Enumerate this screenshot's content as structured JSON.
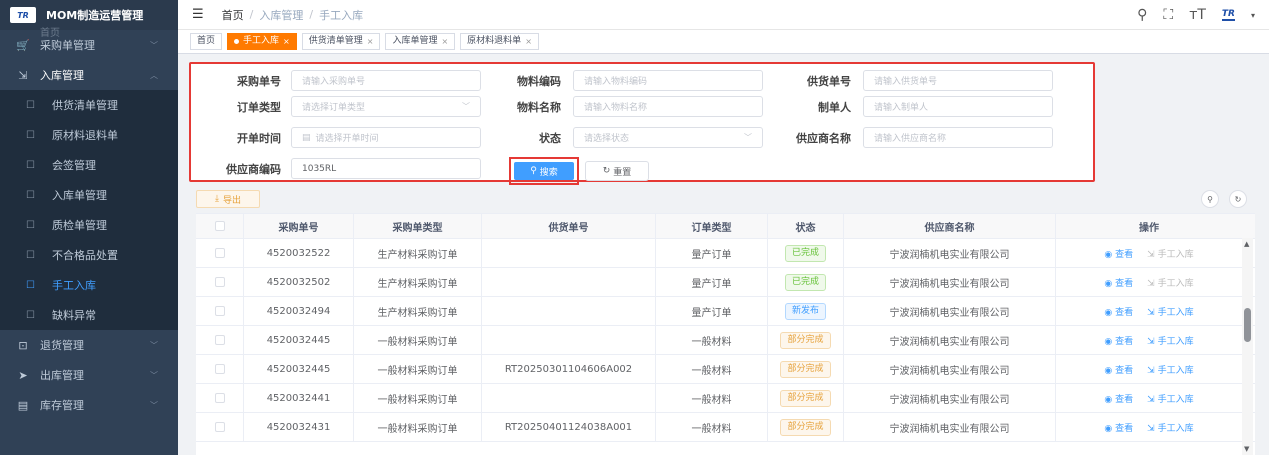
{
  "app": {
    "logo": "TR",
    "title": "MOM制造运营管理",
    "ghost_item": "首页"
  },
  "sidebar": {
    "menu": [
      {
        "label": "采购单管理",
        "icon": "cart-icon",
        "glyph": "🛒",
        "arrow": "﹀",
        "open": false
      },
      {
        "label": "入库管理",
        "icon": "inbox-icon",
        "glyph": "⇲",
        "arrow": "︿",
        "open": true
      }
    ],
    "submenu": [
      {
        "label": "供货清单管理",
        "active": false
      },
      {
        "label": "原材料退料单",
        "active": false
      },
      {
        "label": "会签管理",
        "active": false
      },
      {
        "label": "入库单管理",
        "active": false
      },
      {
        "label": "质检单管理",
        "active": false
      },
      {
        "label": "不合格品处置",
        "active": false
      },
      {
        "label": "手工入库",
        "active": true
      },
      {
        "label": "缺料异常",
        "active": false
      }
    ],
    "menu_after": [
      {
        "label": "退货管理",
        "icon": "return-icon",
        "glyph": "⊡",
        "arrow": "﹀"
      },
      {
        "label": "出库管理",
        "icon": "send-icon",
        "glyph": "➤",
        "arrow": "﹀"
      },
      {
        "label": "库存管理",
        "icon": "warehouse-icon",
        "glyph": "▤",
        "arrow": "﹀"
      }
    ]
  },
  "header": {
    "breadcrumb": [
      "首页",
      "入库管理",
      "手工入库"
    ],
    "brand": "TR"
  },
  "tags": [
    {
      "label": "首页",
      "active": false,
      "closable": false
    },
    {
      "label": "手工入库",
      "active": true,
      "closable": true
    },
    {
      "label": "供货清单管理",
      "active": false,
      "closable": true
    },
    {
      "label": "入库单管理",
      "active": false,
      "closable": true
    },
    {
      "label": "原材料退料单",
      "active": false,
      "closable": true
    }
  ],
  "search": {
    "fields": {
      "purchase_no": {
        "label": "采购单号",
        "placeholder": "请输入采购单号",
        "value": ""
      },
      "material_code": {
        "label": "物料编码",
        "placeholder": "请输入物料编码",
        "value": ""
      },
      "supply_no": {
        "label": "供货单号",
        "placeholder": "请输入供货单号",
        "value": ""
      },
      "order_type": {
        "label": "订单类型",
        "placeholder": "请选择订单类型",
        "value": ""
      },
      "material_name": {
        "label": "物料名称",
        "placeholder": "请输入物料名称",
        "value": ""
      },
      "creator": {
        "label": "制单人",
        "placeholder": "请输入制单人",
        "value": ""
      },
      "open_time": {
        "label": "开单时间",
        "placeholder": "请选择开单时间",
        "value": ""
      },
      "status": {
        "label": "状态",
        "placeholder": "请选择状态",
        "value": ""
      },
      "supplier_name": {
        "label": "供应商名称",
        "placeholder": "请输入供应商名称",
        "value": ""
      },
      "supplier_code": {
        "label": "供应商编码",
        "placeholder": "",
        "value": "1035RL"
      }
    },
    "search_label": "搜索",
    "reset_label": "重置"
  },
  "toolbar": {
    "export_label": "导出"
  },
  "table": {
    "columns": [
      "采购单号",
      "采购单类型",
      "供货单号",
      "订单类型",
      "状态",
      "供应商名称",
      "操作"
    ],
    "view_label": "查看",
    "in_label": "手工入库",
    "rows": [
      {
        "po": "4520032522",
        "po_type": "生产材料采购订单",
        "supply": "",
        "order_type": "量产订单",
        "status": "已完成",
        "status_kind": "done",
        "supplier": "宁波润楠机电实业有限公司",
        "in_enabled": false
      },
      {
        "po": "4520032502",
        "po_type": "生产材料采购订单",
        "supply": "",
        "order_type": "量产订单",
        "status": "已完成",
        "status_kind": "done",
        "supplier": "宁波润楠机电实业有限公司",
        "in_enabled": false
      },
      {
        "po": "4520032494",
        "po_type": "生产材料采购订单",
        "supply": "",
        "order_type": "量产订单",
        "status": "新发布",
        "status_kind": "new",
        "supplier": "宁波润楠机电实业有限公司",
        "in_enabled": true
      },
      {
        "po": "4520032445",
        "po_type": "一般材料采购订单",
        "supply": "",
        "order_type": "一般材料",
        "status": "部分完成",
        "status_kind": "partial",
        "supplier": "宁波润楠机电实业有限公司",
        "in_enabled": true
      },
      {
        "po": "4520032445",
        "po_type": "一般材料采购订单",
        "supply": "RT20250301104606A002",
        "order_type": "一般材料",
        "status": "部分完成",
        "status_kind": "partial",
        "supplier": "宁波润楠机电实业有限公司",
        "in_enabled": true
      },
      {
        "po": "4520032441",
        "po_type": "一般材料采购订单",
        "supply": "",
        "order_type": "一般材料",
        "status": "部分完成",
        "status_kind": "partial",
        "supplier": "宁波润楠机电实业有限公司",
        "in_enabled": true
      },
      {
        "po": "4520032431",
        "po_type": "一般材料采购订单",
        "supply": "RT20250401124038A001",
        "order_type": "一般材料",
        "status": "部分完成",
        "status_kind": "partial",
        "supplier": "宁波润楠机电实业有限公司",
        "in_enabled": true
      }
    ]
  },
  "colors": {
    "accent": "#409eff",
    "tag_active": "#ff7a00",
    "highlight_border": "#e53935",
    "status_done": "#67c23a",
    "status_new": "#409eff",
    "status_partial": "#e6a23c"
  }
}
